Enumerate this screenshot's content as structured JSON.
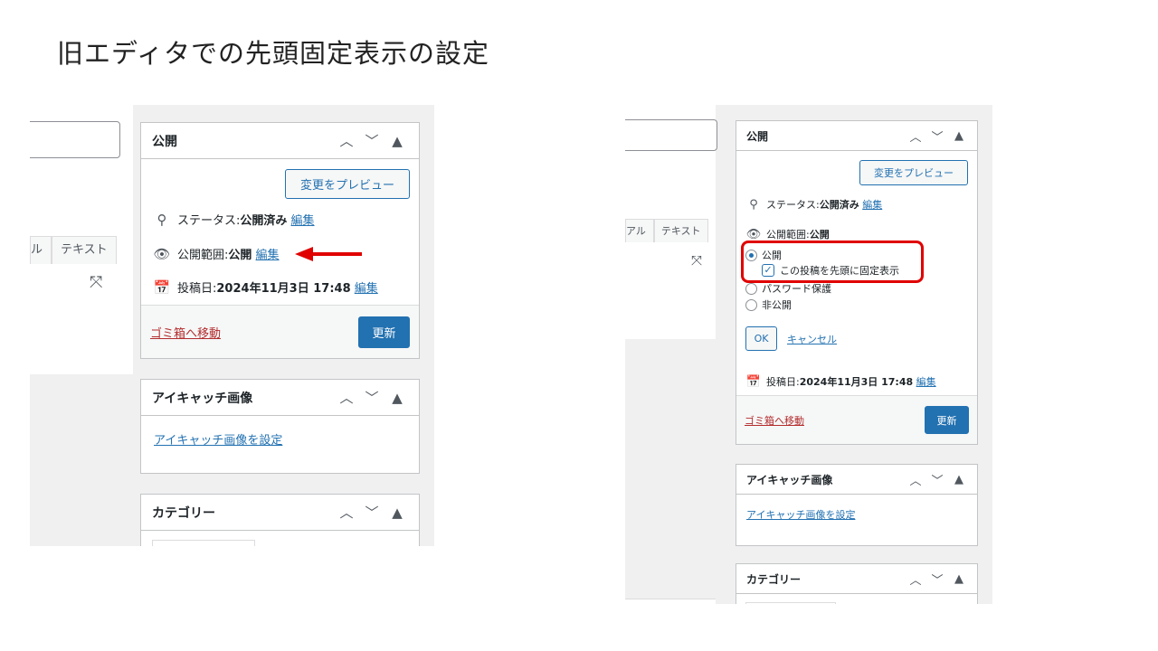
{
  "slide_title": "旧エディタでの先頭固定表示の設定",
  "left": {
    "tabs": [
      "ル",
      "テキスト"
    ],
    "publish": {
      "title": "公開",
      "preview_button": "変更をプレビュー",
      "status_label": "ステータス: ",
      "status_value": "公開済み",
      "visibility_label": "公開範囲: ",
      "visibility_value": "公開",
      "date_label": "投稿日: ",
      "date_value": "2024年11月3日 17:48",
      "edit_link": "編集",
      "trash_link": "ゴミ箱へ移動",
      "update_button": "更新"
    },
    "featured_image": {
      "title": "アイキャッチ画像",
      "set_link": "アイキャッチ画像を設定"
    },
    "category": {
      "title": "カテゴリー"
    }
  },
  "right": {
    "tabs": [
      "アル",
      "テキスト"
    ],
    "publish": {
      "title": "公開",
      "preview_button": "変更をプレビュー",
      "status_label": "ステータス: ",
      "status_value": "公開済み",
      "visibility_label": "公開範囲: ",
      "visibility_value": "公開",
      "edit_link": "編集",
      "radio_public": "公開",
      "sticky_checkbox": "この投稿を先頭に固定表示",
      "radio_password": "パスワード保護",
      "radio_private": "非公開",
      "ok_button": "OK",
      "cancel_link": "キャンセル",
      "date_label": "投稿日: ",
      "date_value": "2024年11月3日 17:48",
      "trash_link": "ゴミ箱へ移動",
      "update_button": "更新"
    },
    "featured_image": {
      "title": "アイキャッチ画像",
      "set_link": "アイキャッチ画像を設定"
    },
    "category": {
      "title": "カテゴリー"
    }
  },
  "icons": {
    "up": "chevron-up-icon",
    "down": "chevron-down-icon",
    "toggle": "triangle-toggle-icon",
    "pin": "pin-icon",
    "eye": "eye-icon",
    "calendar": "calendar-icon",
    "expand": "expand-icon"
  },
  "colors": {
    "link": "#2271b1",
    "primary": "#2271b1",
    "trash": "#b32d2e",
    "highlight": "#e00000",
    "arrow": "#e00000"
  }
}
